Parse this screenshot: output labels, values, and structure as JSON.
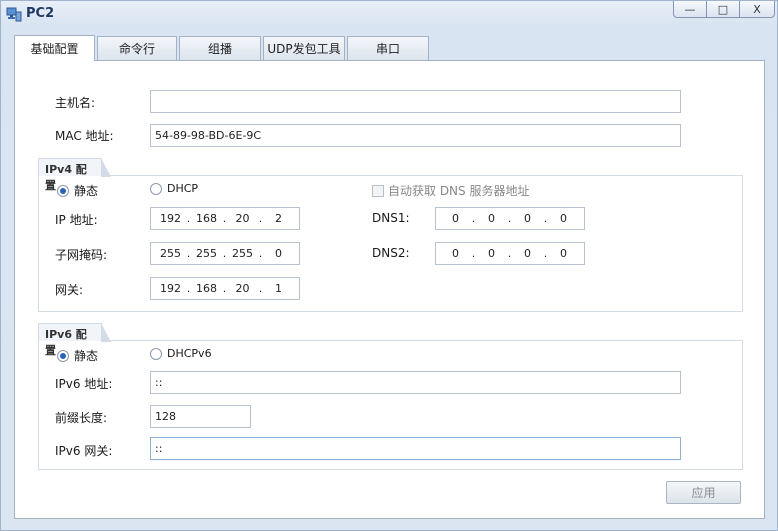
{
  "window": {
    "title": "PC2",
    "min_symbol": "—",
    "max_symbol": "□",
    "close_symbol": "X"
  },
  "tabs": [
    {
      "label": "基础配置",
      "active": true
    },
    {
      "label": "命令行"
    },
    {
      "label": "组播"
    },
    {
      "label": "UDP发包工具"
    },
    {
      "label": "串口"
    }
  ],
  "basic": {
    "hostname_label": "主机名:",
    "hostname_value": "",
    "mac_label": "MAC 地址:",
    "mac_value": "54-89-98-BD-6E-9C"
  },
  "ipv4": {
    "group_title": "IPv4 配置",
    "static_label": "静态",
    "dhcp_label": "DHCP",
    "auto_dns_label": "自动获取 DNS 服务器地址",
    "ip_label": "IP 地址:",
    "ip": [
      "192",
      "168",
      "20",
      "2"
    ],
    "mask_label": "子网掩码:",
    "mask": [
      "255",
      "255",
      "255",
      "0"
    ],
    "gw_label": "网关:",
    "gw": [
      "192",
      "168",
      "20",
      "1"
    ],
    "dns1_label": "DNS1:",
    "dns1": [
      "0",
      "0",
      "0",
      "0"
    ],
    "dns2_label": "DNS2:",
    "dns2": [
      "0",
      "0",
      "0",
      "0"
    ]
  },
  "ipv6": {
    "group_title": "IPv6 配置",
    "static_label": "静态",
    "dhcp_label": "DHCPv6",
    "addr_label": "IPv6 地址:",
    "addr_value": "::",
    "prefix_label": "前缀长度:",
    "prefix_value": "128",
    "gw_label": "IPv6 网关:",
    "gw_value": "::"
  },
  "apply_label": "应用",
  "colors": {
    "accent": "#2a63b6",
    "title": "#1f3a63"
  }
}
